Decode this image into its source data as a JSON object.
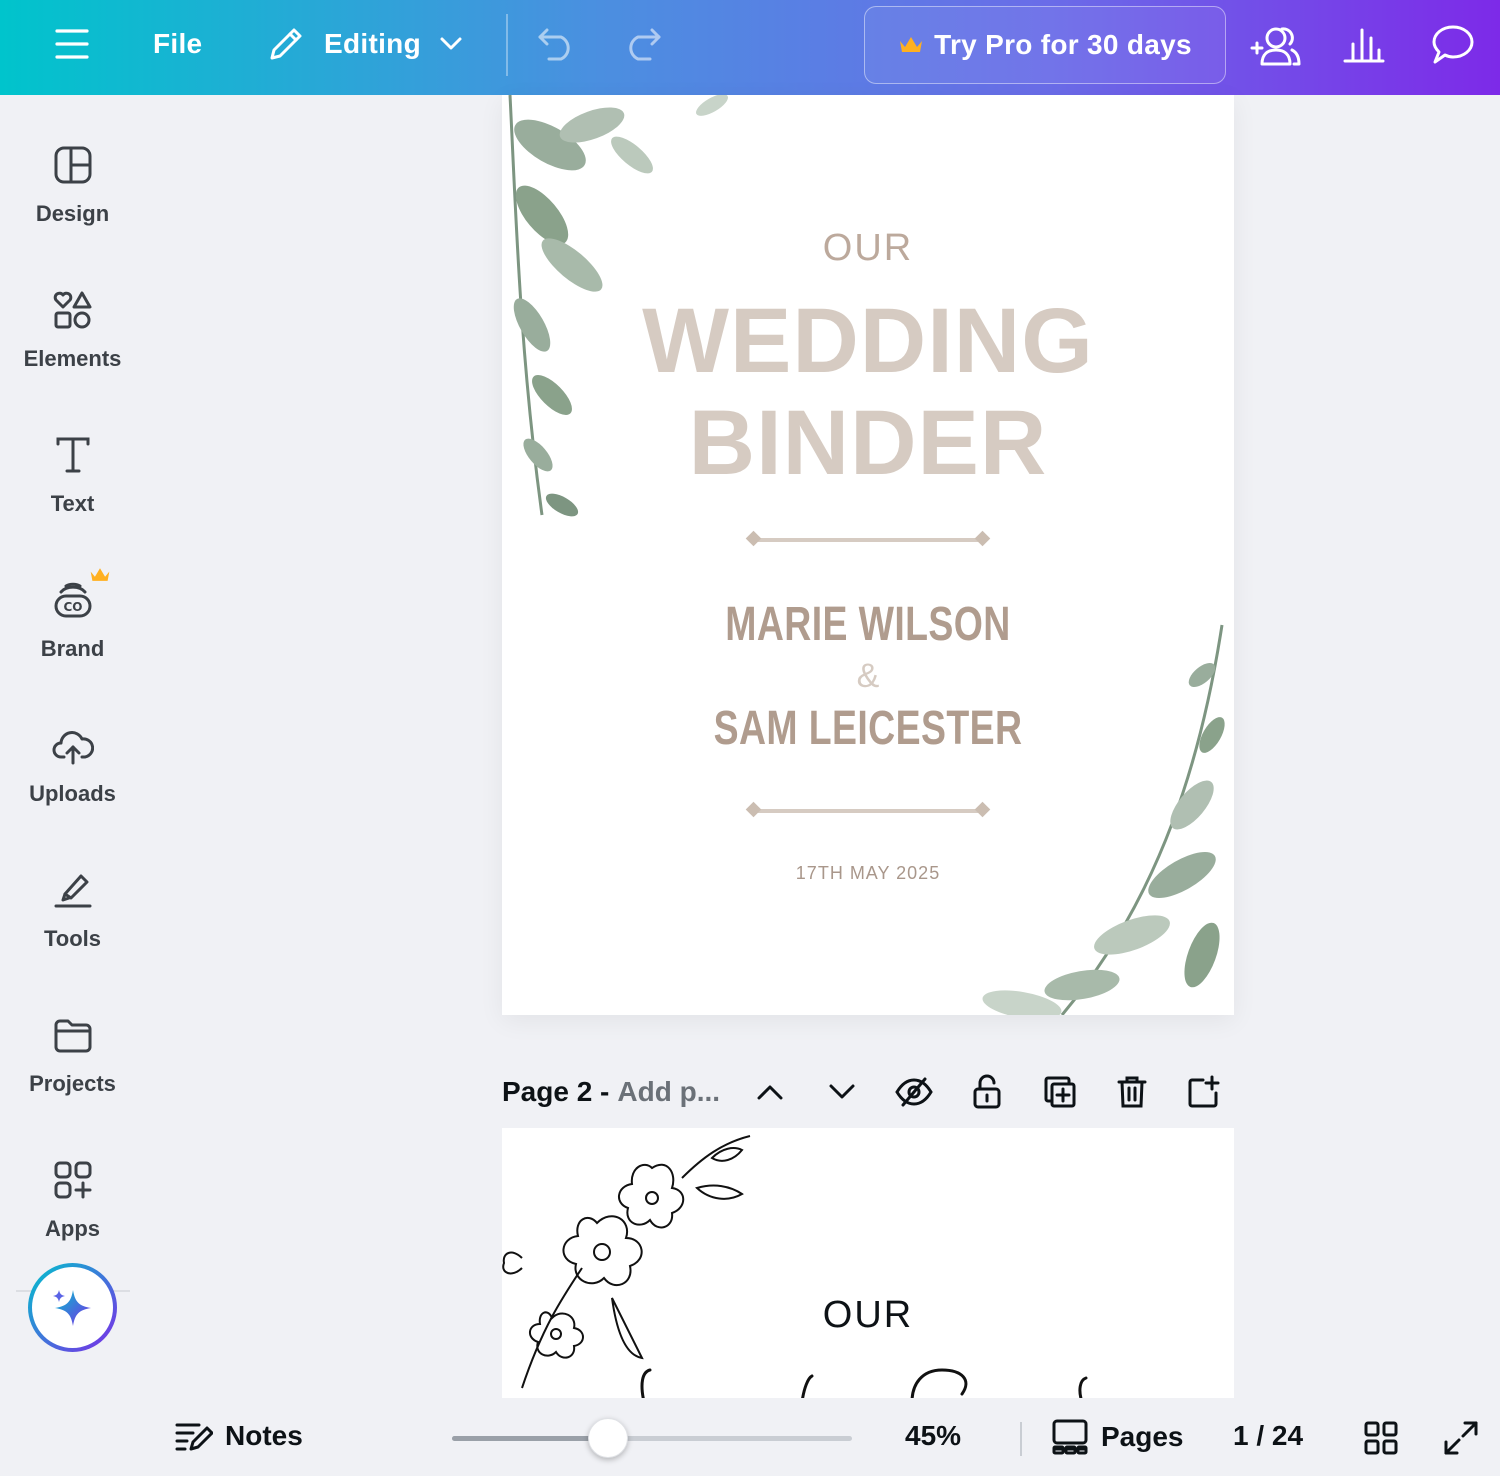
{
  "topbar": {
    "file_label": "File",
    "mode_label": "Editing",
    "pro_label": "Try Pro for 30 days"
  },
  "sidebar": {
    "items": [
      {
        "label": "Design",
        "icon": "design-icon"
      },
      {
        "label": "Elements",
        "icon": "elements-icon"
      },
      {
        "label": "Text",
        "icon": "text-icon"
      },
      {
        "label": "Brand",
        "icon": "brand-icon"
      },
      {
        "label": "Uploads",
        "icon": "upload-cloud-icon"
      },
      {
        "label": "Tools",
        "icon": "tools-icon"
      },
      {
        "label": "Projects",
        "icon": "folder-icon"
      },
      {
        "label": "Apps",
        "icon": "apps-icon"
      }
    ]
  },
  "page1": {
    "our": "OUR",
    "title_line1": "WEDDING",
    "title_line2": "BINDER",
    "name1": "MARIE WILSON",
    "amp": "&",
    "name2": "SAM LEICESTER",
    "date": "17TH MAY 2025"
  },
  "page2_header": {
    "label": "Page 2 -",
    "add_placeholder": "Add p..."
  },
  "page2": {
    "our": "OUR"
  },
  "bottombar": {
    "notes_label": "Notes",
    "zoom_value": "45%",
    "zoom_fraction": 0.39,
    "pages_label": "Pages",
    "page_counter": "1 / 24"
  },
  "colors": {
    "accent_start": "#00c4cc",
    "accent_end": "#7d2ae8",
    "title_beige": "#d6cbc2",
    "name_brown": "#b09c8e",
    "pro_crown": "#ffb020"
  }
}
